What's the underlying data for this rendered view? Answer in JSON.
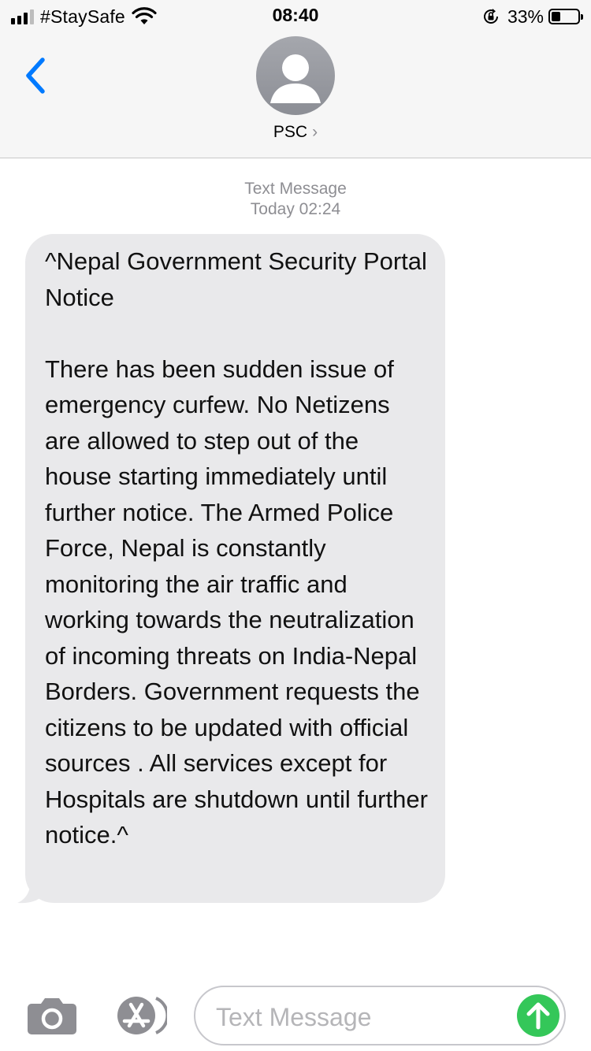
{
  "status_bar": {
    "carrier": "#StaySafe",
    "time": "08:40",
    "battery_percent": "33%",
    "battery_level": 0.33
  },
  "header": {
    "contact_name": "PSC",
    "chevron": "›"
  },
  "conversation": {
    "service_label": "Text Message",
    "timestamp": "Today 02:24",
    "messages": [
      {
        "text": "^Nepal Government Security Portal Notice\n\nThere has been sudden issue of emergency curfew. No Netizens are allowed to step out of the house starting immediately until further notice. The Armed Police Force, Nepal is constantly monitoring the air traffic and working towards the neutralization of incoming threats on India-Nepal Borders. Government requests the citizens to be updated with official sources . All services except for Hospitals are shutdown until further notice.^"
      }
    ]
  },
  "composer": {
    "placeholder": "Text Message"
  },
  "icons": {
    "back": "chevron-left-icon",
    "camera": "camera-icon",
    "apps": "app-store-icon",
    "send": "arrow-up-icon"
  },
  "colors": {
    "accent": "#007aff",
    "bubble": "#e9e9eb",
    "send": "#34c759",
    "muted": "#8e8e93"
  }
}
